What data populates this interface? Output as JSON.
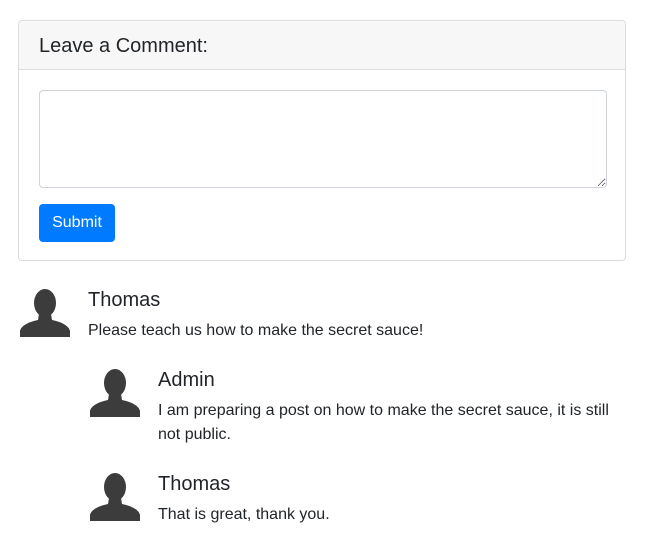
{
  "comment_form": {
    "title": "Leave a Comment:",
    "textarea_value": "",
    "submit_label": "Submit"
  },
  "comments": [
    {
      "author": "Thomas",
      "text": "Please teach us how to make the secret sauce!",
      "avatar_icon": "user-silhouette-icon",
      "replies": [
        {
          "author": "Admin",
          "text": "I am preparing a post on how to make the secret sauce, it is still not public.",
          "avatar_icon": "user-silhouette-icon"
        },
        {
          "author": "Thomas",
          "text": "That is great, thank you.",
          "avatar_icon": "user-silhouette-icon"
        }
      ]
    }
  ],
  "colors": {
    "accent": "#007bff",
    "header_bg": "#f7f7f7",
    "avatar": "#3c3c3c"
  }
}
